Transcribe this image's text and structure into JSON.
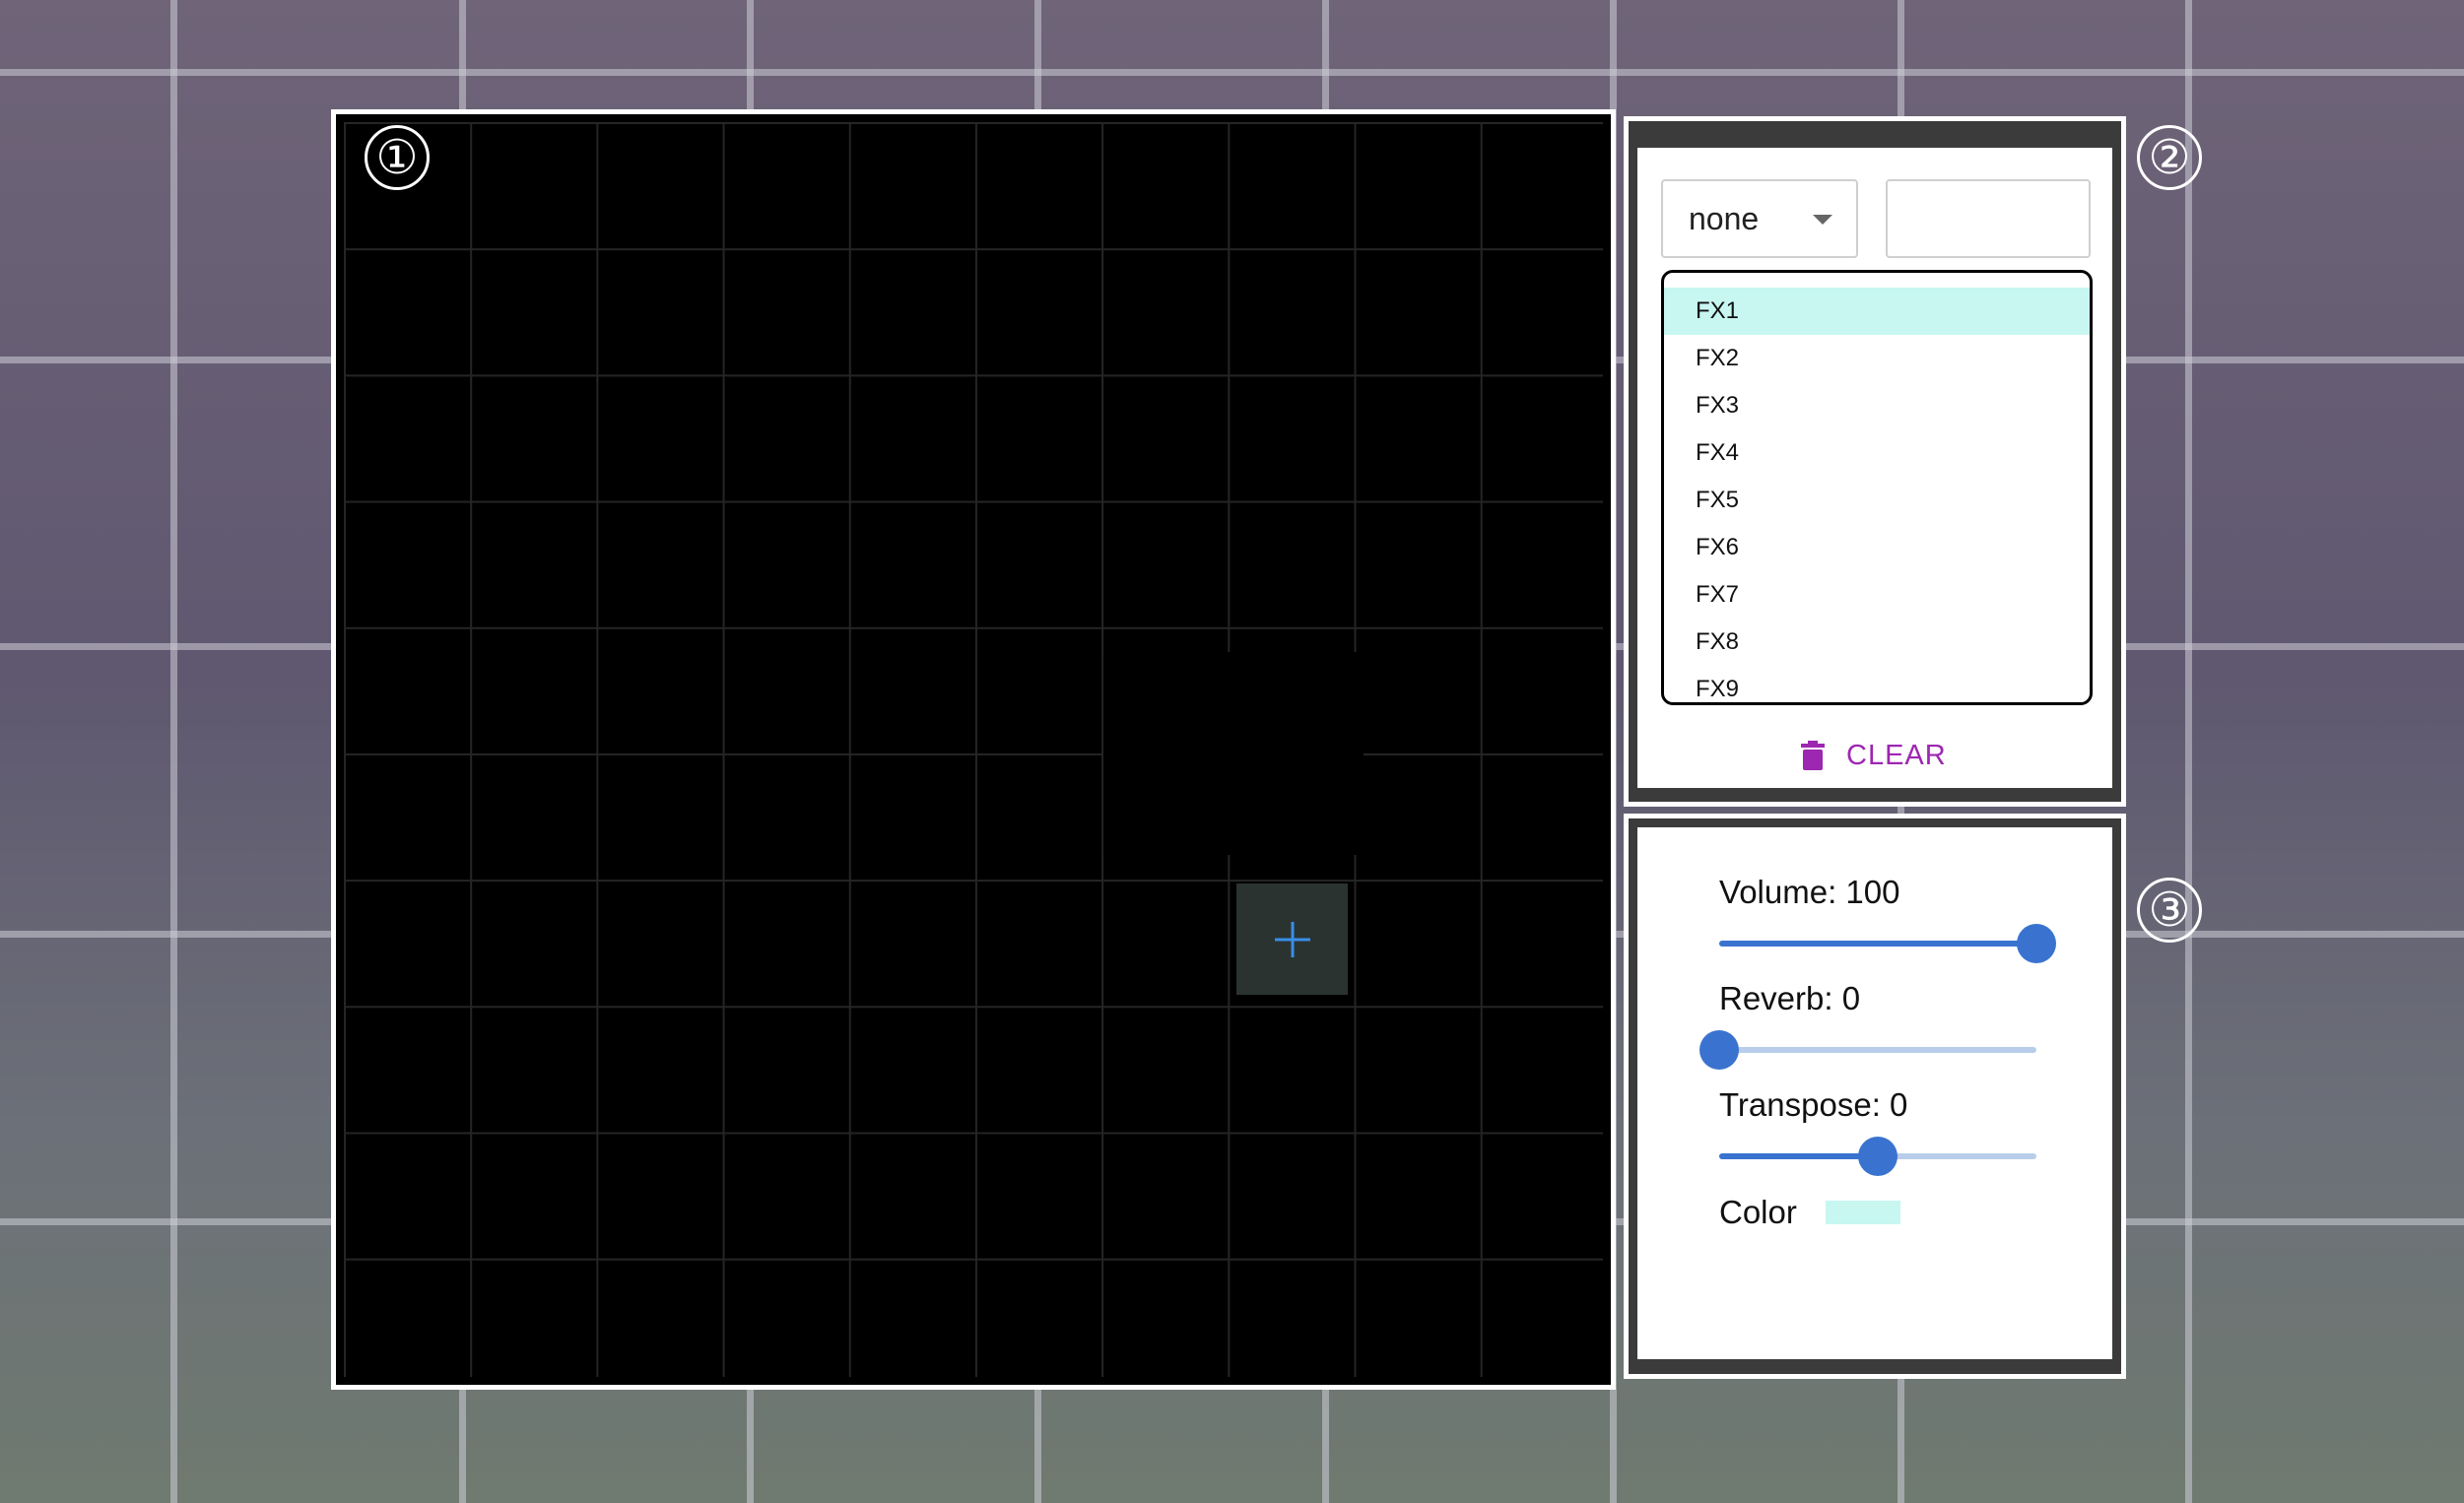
{
  "badges": {
    "grid": "①",
    "fx": "②",
    "controls": "③"
  },
  "grid": {
    "add_icon": "plus-icon"
  },
  "fx": {
    "select_value": "none",
    "name_value": "",
    "items": [
      "FX1",
      "FX2",
      "FX3",
      "FX4",
      "FX5",
      "FX6",
      "FX7",
      "FX8",
      "FX9"
    ],
    "selected_item": "FX1",
    "clear_label": "CLEAR",
    "clear_icon": "trash-icon",
    "accent_color": "#9c27b0",
    "selected_color": "#c8f7f2"
  },
  "controls": {
    "volume": {
      "label": "Volume: 100",
      "value": 100,
      "min": 0,
      "max": 100
    },
    "reverb": {
      "label": "Reverb: 0",
      "value": 0,
      "min": 0,
      "max": 100
    },
    "transpose": {
      "label": "Transpose: 0",
      "value": 0,
      "min": -12,
      "max": 12
    },
    "color_label": "Color",
    "color_value": "#c8f7f2",
    "slider_color": "#3a73cf"
  }
}
